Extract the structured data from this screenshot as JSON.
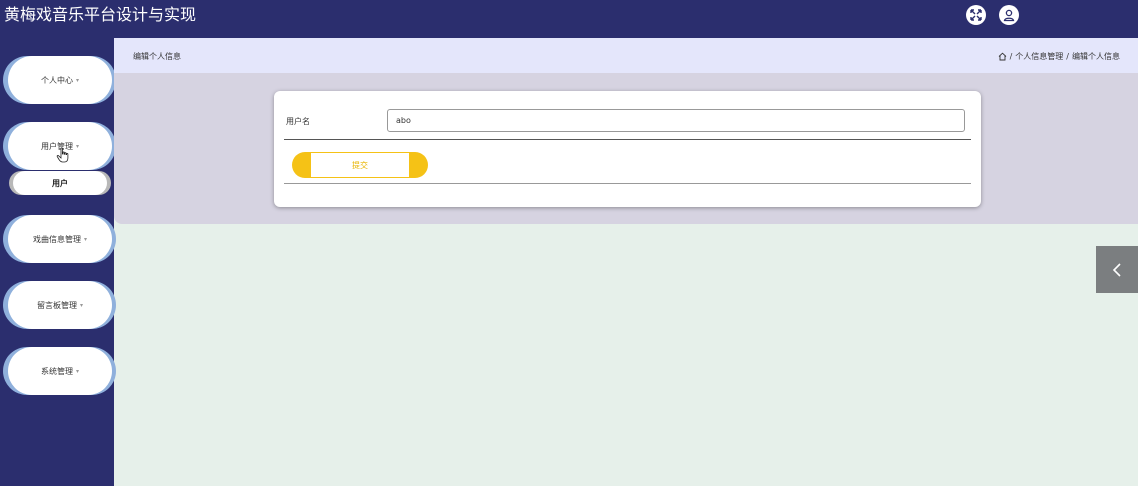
{
  "app": {
    "title": "黄梅戏音乐平台设计与实现"
  },
  "header_icons": {
    "fullscreen": "fullscreen-icon",
    "user": "user-icon"
  },
  "sidebar": {
    "items": [
      {
        "label": "个人中心",
        "caret": "▾"
      },
      {
        "label": "用户管理",
        "caret": "▾"
      },
      {
        "label": "戏曲信息管理",
        "caret": "▾"
      },
      {
        "label": "留言板管理",
        "caret": "▾"
      },
      {
        "label": "系统管理",
        "caret": "▾"
      }
    ],
    "subitem": {
      "label": "用户"
    }
  },
  "main": {
    "page_title": "编辑个人信息",
    "breadcrumb": [
      "个人信息管理",
      "编辑个人信息"
    ],
    "breadcrumb_sep": "/"
  },
  "form": {
    "username_label": "用户名",
    "username_value": "abo",
    "submit_label": "提交"
  },
  "colors": {
    "nav_bg": "#2b2e6e",
    "accent": "#f5c216",
    "pill_edge": "#8fb0dc",
    "content_bg": "#e6f0ea"
  }
}
